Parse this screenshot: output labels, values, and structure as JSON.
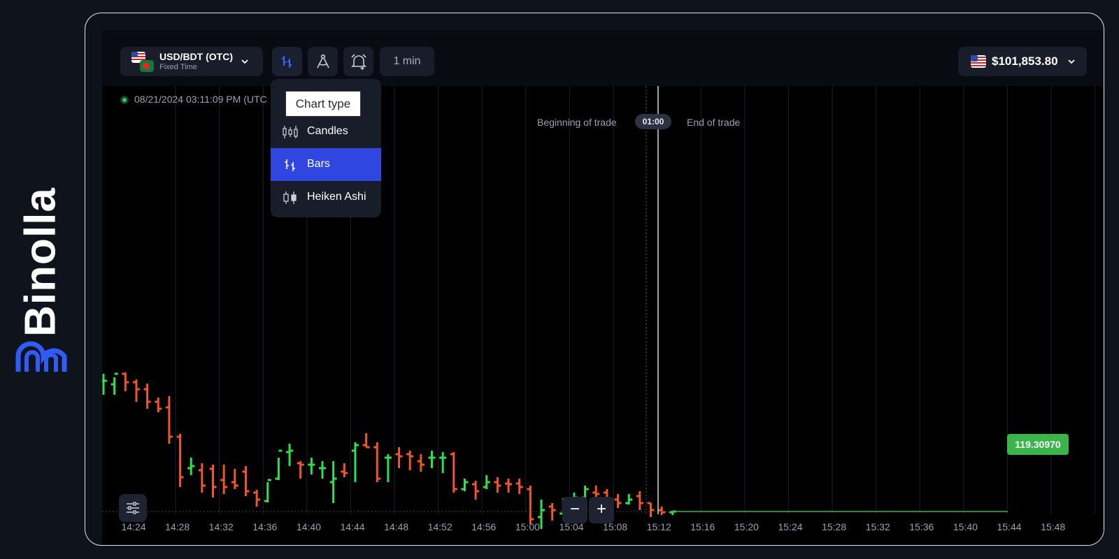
{
  "brand": {
    "name": "Binolla",
    "logo_color": "#2f5cf5"
  },
  "topbar": {
    "asset": {
      "name": "USD/BDT (OTC)",
      "mode": "Fixed Time",
      "icon": "chevron-down-icon"
    },
    "chart_type_icon": "bars-chart-icon",
    "drawing_icon": "compass-drawing-icon",
    "alert_icon": "alarm-add-icon",
    "timeframe": "1 min",
    "balance": {
      "value": "$101,853.80",
      "currency_flag": "us-flag-icon"
    }
  },
  "chart_type_menu": {
    "tooltip": "Chart type",
    "items": [
      {
        "label": "Candles",
        "icon": "candles-icon",
        "selected": false
      },
      {
        "label": "Bars",
        "icon": "bars-icon",
        "selected": true
      },
      {
        "label": "Heiken Ashi",
        "icon": "heiken-ashi-icon",
        "selected": false
      }
    ],
    "selected_color": "#2f46e0"
  },
  "chart": {
    "timestamp": "08/21/2024 03:11:09 PM  (UTC",
    "beginning_label": "Beginning of trade",
    "countdown": "01:00",
    "end_label": "End of trade",
    "current_price": "119.30970",
    "zoom_out": "−",
    "zoom_in": "+"
  },
  "chart_data": {
    "type": "bar",
    "chart_style": "ohlc-bars",
    "up_color": "#2ee04d",
    "down_color": "#f0552e",
    "time_ticks": [
      "14:24",
      "14:28",
      "14:32",
      "14:36",
      "14:40",
      "14:44",
      "14:48",
      "14:52",
      "14:56",
      "15:00",
      "15:04",
      "15:08",
      "15:12",
      "15:16",
      "15:20",
      "15:24",
      "15:28",
      "15:32",
      "15:36",
      "15:40",
      "15:44",
      "15:48"
    ],
    "current_price": 119.3097,
    "bars": [
      {
        "o": 0.9,
        "h": 1.0,
        "l": 0.7,
        "c": 0.9
      },
      {
        "o": 0.85,
        "h": 0.95,
        "l": 0.7,
        "c": 1.0
      },
      {
        "o": 1.0,
        "h": 1.02,
        "l": 0.75,
        "c": 0.88
      },
      {
        "o": 0.88,
        "h": 0.92,
        "l": 0.6,
        "c": 0.78
      },
      {
        "o": 0.78,
        "h": 0.86,
        "l": 0.5,
        "c": 0.6
      },
      {
        "o": 0.6,
        "h": 0.66,
        "l": 0.45,
        "c": 0.5
      },
      {
        "o": 0.52,
        "h": 0.68,
        "l": 0.0,
        "c": 0.1
      },
      {
        "o": 0.1,
        "h": 0.14,
        "l": -0.62,
        "c": -0.48
      },
      {
        "o": -0.35,
        "h": -0.2,
        "l": -0.45,
        "c": -0.32
      },
      {
        "o": -0.38,
        "h": -0.28,
        "l": -0.7,
        "c": -0.6
      },
      {
        "o": -0.36,
        "h": -0.3,
        "l": -0.77,
        "c": -0.62
      },
      {
        "o": -0.52,
        "h": -0.3,
        "l": -0.72,
        "c": -0.62
      },
      {
        "o": -0.55,
        "h": -0.36,
        "l": -0.65,
        "c": -0.6
      },
      {
        "o": -0.4,
        "h": -0.32,
        "l": -0.75,
        "c": -0.68
      },
      {
        "o": -0.7,
        "h": -0.66,
        "l": -0.9,
        "c": -0.8
      },
      {
        "o": -0.82,
        "h": -0.55,
        "l": -0.84,
        "c": -0.52
      },
      {
        "o": -0.5,
        "h": -0.2,
        "l": -0.52,
        "c": -0.1
      },
      {
        "o": -0.12,
        "h": 0.0,
        "l": -0.32,
        "c": -0.1
      },
      {
        "o": -0.28,
        "h": -0.25,
        "l": -0.5,
        "c": -0.3
      },
      {
        "o": -0.3,
        "h": -0.2,
        "l": -0.44,
        "c": -0.3
      },
      {
        "o": -0.35,
        "h": -0.25,
        "l": -0.5,
        "c": -0.35
      },
      {
        "o": -0.55,
        "h": -0.25,
        "l": -0.85,
        "c": -0.5
      },
      {
        "o": -0.4,
        "h": -0.28,
        "l": -0.48,
        "c": -0.42
      },
      {
        "o": -0.1,
        "h": 0.02,
        "l": -0.55,
        "c": -0.02
      },
      {
        "o": -0.02,
        "h": 0.15,
        "l": -0.05,
        "c": -0.05
      },
      {
        "o": -0.05,
        "h": 0.02,
        "l": -0.55,
        "c": -0.5
      },
      {
        "o": -0.2,
        "h": -0.15,
        "l": -0.55,
        "c": -0.2
      },
      {
        "o": -0.15,
        "h": -0.05,
        "l": -0.35,
        "c": -0.18
      },
      {
        "o": -0.15,
        "h": -0.1,
        "l": -0.38,
        "c": -0.18
      },
      {
        "o": -0.25,
        "h": -0.15,
        "l": -0.4,
        "c": -0.3
      },
      {
        "o": -0.2,
        "h": -0.1,
        "l": -0.35,
        "c": -0.2
      },
      {
        "o": -0.2,
        "h": -0.12,
        "l": -0.42,
        "c": -0.2
      },
      {
        "o": -0.15,
        "h": -0.12,
        "l": -0.7,
        "c": -0.65
      },
      {
        "o": -0.65,
        "h": -0.5,
        "l": -0.68,
        "c": -0.55
      },
      {
        "o": -0.58,
        "h": -0.53,
        "l": -0.8,
        "c": -0.68
      },
      {
        "o": -0.62,
        "h": -0.45,
        "l": -0.65,
        "c": -0.55
      },
      {
        "o": -0.55,
        "h": -0.48,
        "l": -0.7,
        "c": -0.6
      },
      {
        "o": -0.57,
        "h": -0.5,
        "l": -0.7,
        "c": -0.58
      },
      {
        "o": -0.57,
        "h": -0.5,
        "l": -0.72,
        "c": -0.62
      },
      {
        "o": -0.65,
        "h": -0.6,
        "l": -1.15,
        "c": -1.08
      },
      {
        "o": -1.05,
        "h": -0.8,
        "l": -1.22,
        "c": -0.95
      },
      {
        "o": -0.9,
        "h": -0.85,
        "l": -1.1,
        "c": -0.95
      },
      {
        "o": -1.0,
        "h": -0.78,
        "l": -1.0,
        "c": -0.85
      },
      {
        "o": -0.85,
        "h": -0.7,
        "l": -0.95,
        "c": -0.77
      },
      {
        "o": -0.77,
        "h": -0.6,
        "l": -0.78,
        "c": -0.65
      },
      {
        "o": -0.7,
        "h": -0.6,
        "l": -0.8,
        "c": -0.72
      },
      {
        "o": -0.7,
        "h": -0.65,
        "l": -0.9,
        "c": -0.82
      },
      {
        "o": -0.8,
        "h": -0.72,
        "l": -0.92,
        "c": -0.85
      },
      {
        "o": -0.85,
        "h": -0.72,
        "l": -0.87,
        "c": -0.8
      },
      {
        "o": -0.75,
        "h": -0.68,
        "l": -0.95,
        "c": -0.85
      },
      {
        "o": -0.85,
        "h": -0.85,
        "l": -1.05,
        "c": -0.95
      },
      {
        "o": -0.95,
        "h": -0.9,
        "l": -1.02,
        "c": -0.98
      },
      {
        "o": -0.98,
        "h": -0.96,
        "l": -1.02,
        "c": -0.97
      }
    ]
  }
}
